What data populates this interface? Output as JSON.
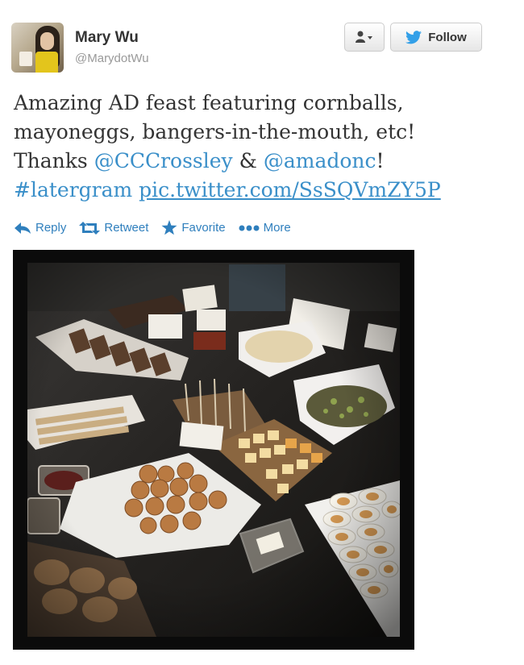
{
  "author": {
    "name": "Mary Wu",
    "handle": "@MarydotWu"
  },
  "buttons": {
    "follow_label": "Follow"
  },
  "tweet": {
    "line1": "Amazing AD feast featuring cornballs,",
    "line2": "mayoneggs, bangers-in-the-mouth, etc!",
    "thanks": "Thanks ",
    "mention1": "@CCCrossley",
    "amp": " & ",
    "mention2": "@amadonc",
    "bang": "!",
    "hashtag": "#latergram",
    "space": " ",
    "link": "pic.twitter.com/SsSQVmZY5P"
  },
  "actions": {
    "reply": "Reply",
    "retweet": "Retweet",
    "favorite": "Favorite",
    "more": "More"
  },
  "colors": {
    "link_blue": "#3a8fc9",
    "action_blue": "#2f7fbd",
    "follow_bird": "#33a0e8",
    "name_gray": "#333333",
    "handle_gray": "#999999"
  },
  "icons": [
    "user-icon",
    "twitter-bird-icon",
    "reply-icon",
    "retweet-icon",
    "star-icon",
    "more-dots-icon"
  ]
}
